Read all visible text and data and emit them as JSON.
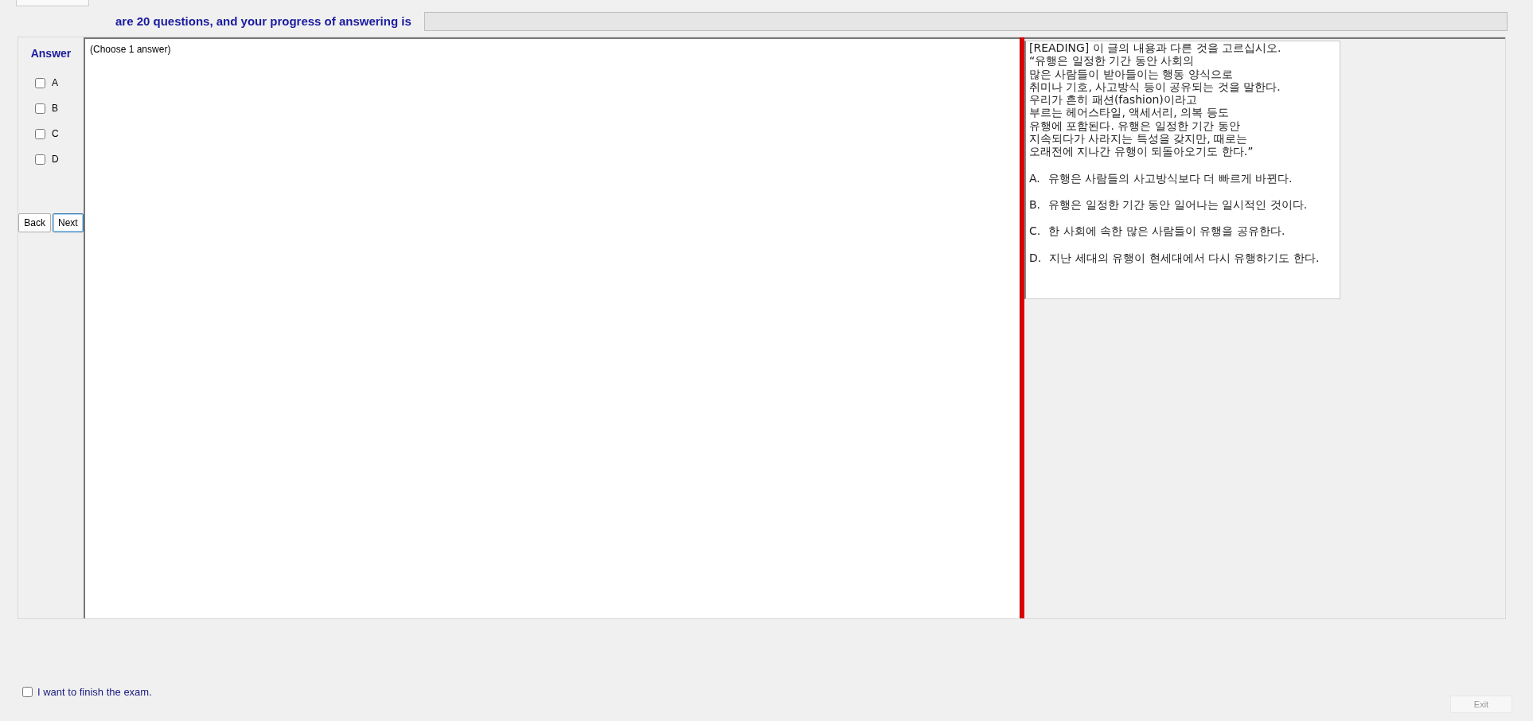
{
  "header": {
    "text": "are 20 questions, and your progress of answering is",
    "progress": {
      "level": 0
    }
  },
  "answer_panel": {
    "title": "Answer",
    "options": [
      {
        "label": "A",
        "checked": false
      },
      {
        "label": "B",
        "checked": false
      },
      {
        "label": "C",
        "checked": false
      },
      {
        "label": "D",
        "checked": false
      }
    ],
    "buttons": [
      {
        "label": "Back",
        "focused": false
      },
      {
        "label": "Next",
        "focused": true
      }
    ]
  },
  "question": {
    "instruction": "(Choose 1 answer)"
  },
  "reading": {
    "lines": [
      "[READING] 이 글의 내용과 다른 것을 고르십시오.",
      "“유행은 일정한 기간 동안 사회의",
      "많은 사람들이 받아들이는 행동 양식으로",
      "취미나 기호, 사고방식 등이 공유되는 것을 말한다.",
      "우리가 흔히 패션(fashion)이라고",
      "부르는 헤어스타일, 액세서리, 의복 등도",
      "유행에 포함된다. 유행은 일정한 기간 동안",
      "지속되다가 사라지는 특성을 갖지만, 때로는",
      "오래전에 지나간 유행이 되돌아오기도 한다.”"
    ],
    "choices": [
      {
        "letter": "A.",
        "text": "유행은 사람들의 사고방식보다 더 빠르게 바뀐다."
      },
      {
        "letter": "B.",
        "text": "유행은 일정한 기간 동안 일어나는 일시적인 것이다."
      },
      {
        "letter": "C.",
        "text": "한 사회에 속한 많은 사람들이 유행을 공유한다."
      },
      {
        "letter": "D.",
        "text": "지난 세대의 유행이 현세대에서 다시 유행하기도 한다."
      }
    ]
  },
  "footer": {
    "finish": {
      "label": "I want to finish the exam.",
      "checked": false
    },
    "exit": {
      "label": "Exit",
      "disabled": true
    }
  }
}
